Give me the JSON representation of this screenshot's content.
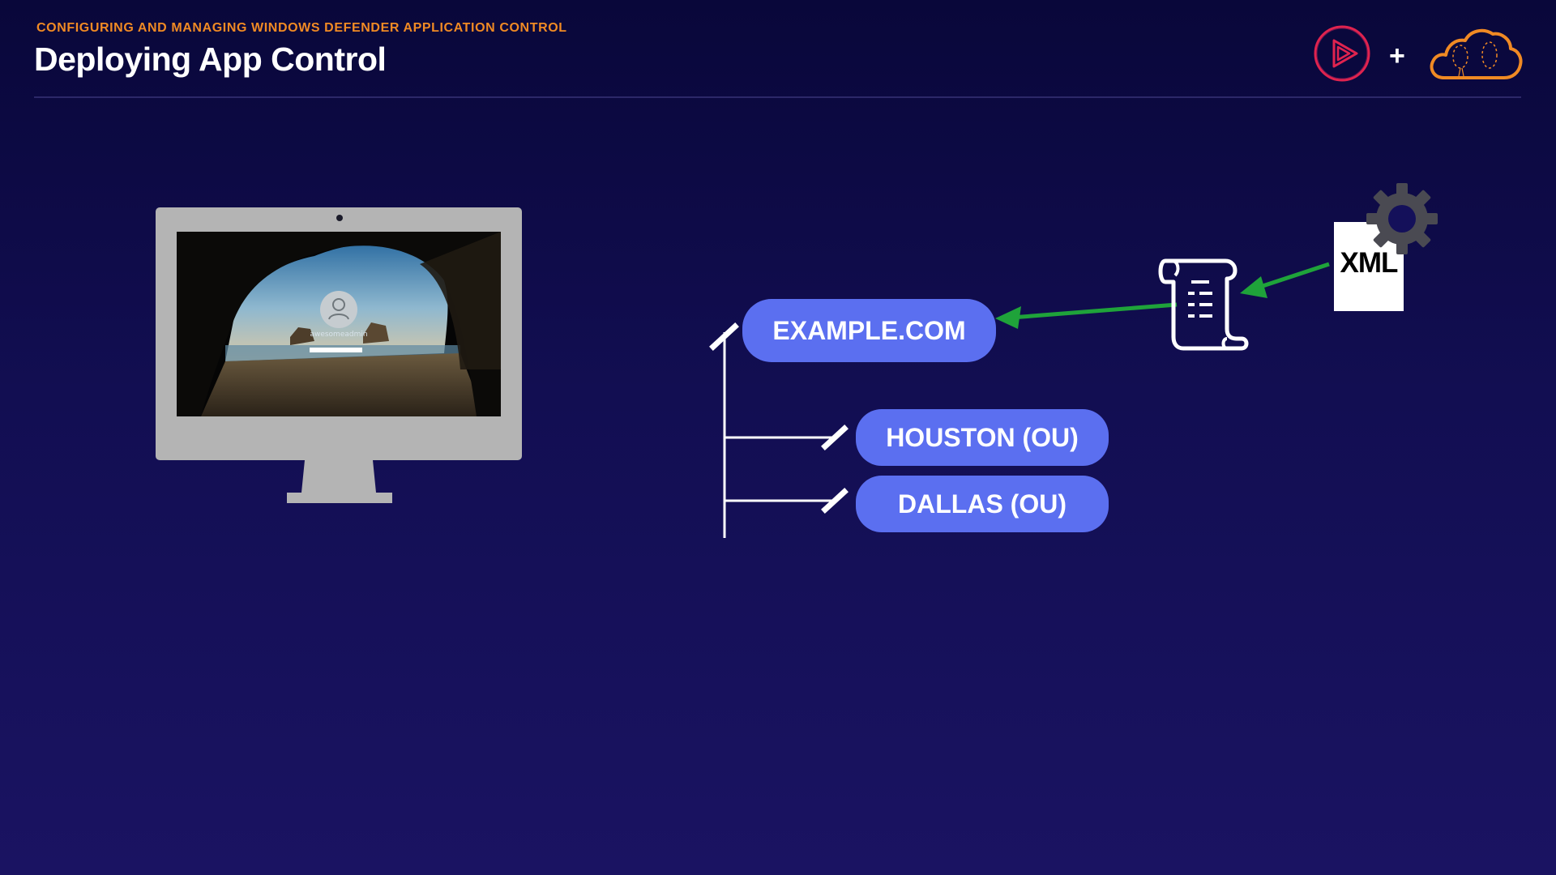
{
  "header": {
    "eyebrow": "CONFIGURING AND MANAGING WINDOWS DEFENDER APPLICATION CONTROL",
    "title": "Deploying App Control"
  },
  "logos": {
    "left_icon": "pluralsight-play-icon",
    "separator": "+",
    "right_icon": "cloud-icon",
    "left_color": "#e0234f",
    "right_color": "#f08a24"
  },
  "monitor": {
    "login_username": "awesomeadmin"
  },
  "domain_tree": {
    "root": "EXAMPLE.COM",
    "ous": [
      "HOUSTON (OU)",
      "DALLAS (OU)"
    ]
  },
  "policy": {
    "file_label": "XML",
    "script_icon": "scroll-document-icon",
    "gear_icon": "gear-icon",
    "arrow_color": "#1fa33a"
  },
  "colors": {
    "pill": "#5b6ff0",
    "eyebrow": "#f08a24",
    "background": "#120e52"
  }
}
